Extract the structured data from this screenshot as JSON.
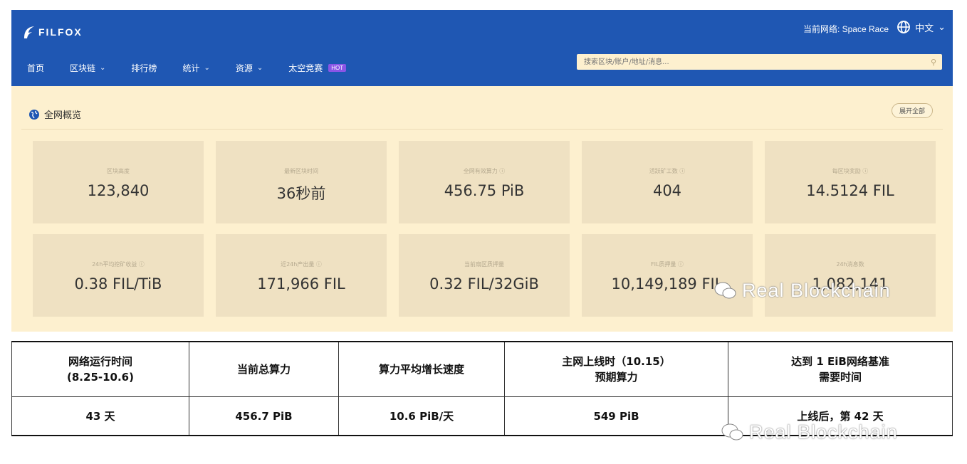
{
  "header": {
    "logo_text": "FILFOX",
    "network_label": "当前网络: Space Race",
    "language": "中文"
  },
  "nav": {
    "items": [
      {
        "label": "首页",
        "dropdown": false
      },
      {
        "label": "区块链",
        "dropdown": true
      },
      {
        "label": "排行榜",
        "dropdown": false
      },
      {
        "label": "统计",
        "dropdown": true
      },
      {
        "label": "资源",
        "dropdown": true
      },
      {
        "label": "太空竞赛",
        "dropdown": false
      }
    ],
    "hot_badge": "HOT",
    "search_placeholder": "搜索区块/账户/地址/消息..."
  },
  "overview": {
    "title": "全网概览",
    "expand_label": "展开全部",
    "stats": [
      {
        "label": "区块高度",
        "value": "123,840",
        "info": false
      },
      {
        "label": "最新区块时间",
        "value": "36秒前",
        "info": false
      },
      {
        "label": "全网有效算力",
        "value": "456.75 PiB",
        "info": true
      },
      {
        "label": "活跃矿工数",
        "value": "404",
        "info": true
      },
      {
        "label": "每区块奖励",
        "value": "14.5124 FIL",
        "info": true
      },
      {
        "label": "24h平均挖矿收益",
        "value": "0.38 FIL/TiB",
        "info": true
      },
      {
        "label": "近24h产出量",
        "value": "171,966 FIL",
        "info": true
      },
      {
        "label": "当前扇区质押量",
        "value": "0.32 FIL/32GiB",
        "info": false
      },
      {
        "label": "FIL质押量",
        "value": "10,149,189 FIL",
        "info": true
      },
      {
        "label": "24h消息数",
        "value": "1,082,141",
        "info": false
      }
    ]
  },
  "watermark": "Real Blockchain",
  "table": {
    "headers": [
      [
        "网络运行时间",
        "(8.25-10.6)"
      ],
      [
        "当前总算力"
      ],
      [
        "算力平均增长速度"
      ],
      [
        "主网上线时（10.15）",
        "预期算力"
      ],
      [
        "达到 1 EiB网络基准",
        "需要时间"
      ]
    ],
    "row": [
      "43 天",
      "456.7 PiB",
      "10.6 PiB/天",
      "549 PiB",
      "上线后，第 42 天"
    ]
  },
  "colors": {
    "brand_blue": "#1f57b3",
    "panel_bg": "#fdf0cf",
    "stat_bg": "#efe1c2",
    "hot_badge": "#8a55e6"
  }
}
